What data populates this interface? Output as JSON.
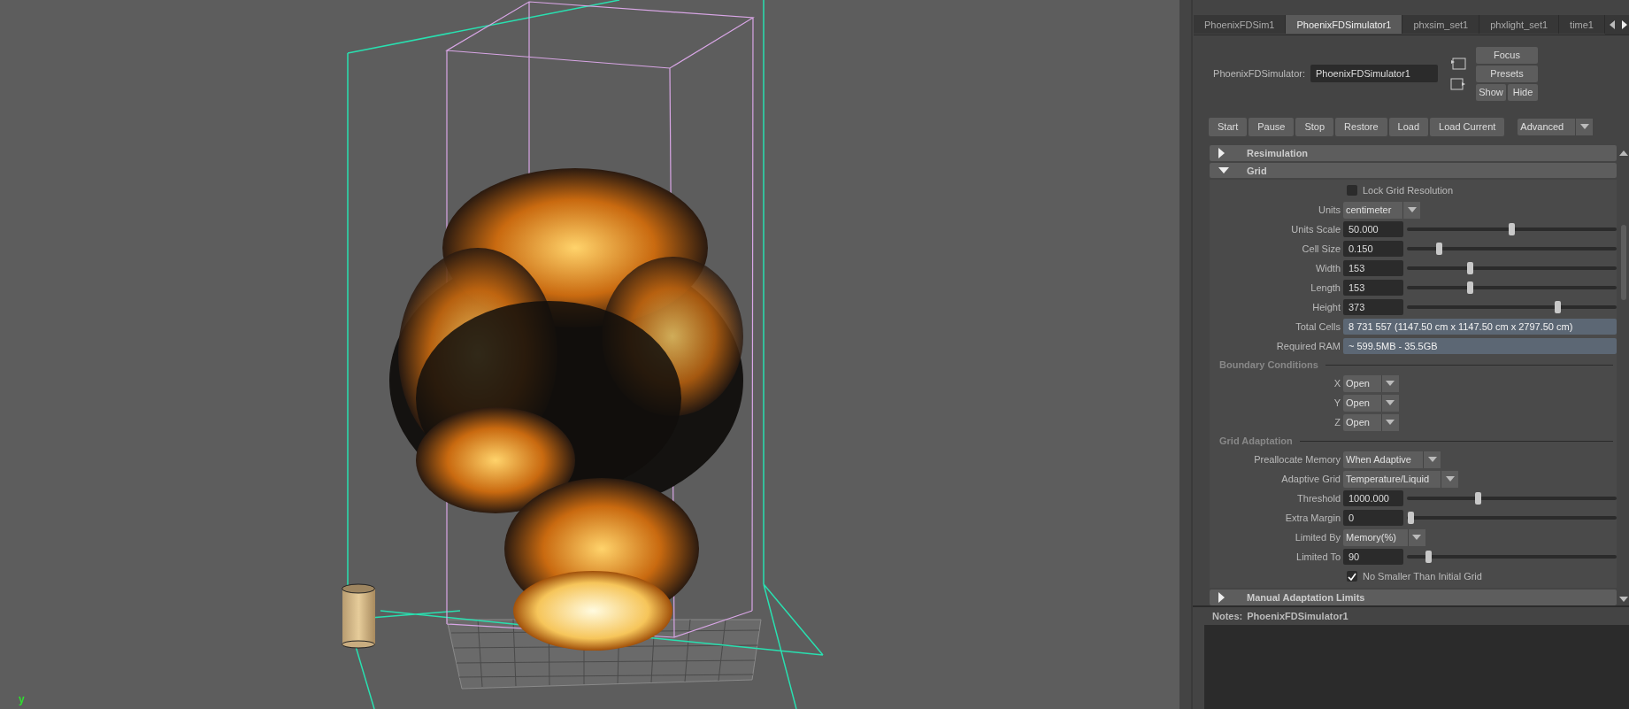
{
  "viewport": {
    "axis_label": "y"
  },
  "tabs": [
    {
      "label": "PhoenixFDSim1",
      "selected": false
    },
    {
      "label": "PhoenixFDSimulator1",
      "selected": true
    },
    {
      "label": "phxsim_set1",
      "selected": false
    },
    {
      "label": "phxlight_set1",
      "selected": false
    },
    {
      "label": "time1",
      "selected": false
    }
  ],
  "node": {
    "label": "PhoenixFDSimulator:",
    "value": "PhoenixFDSimulator1"
  },
  "node_buttons": [
    "Focus",
    "Presets"
  ],
  "view_buttons": [
    "Show",
    "Hide"
  ],
  "actions": [
    "Start",
    "Pause",
    "Stop",
    "Restore",
    "Load",
    "Load Current"
  ],
  "mode": {
    "value": "Advanced"
  },
  "sections": [
    {
      "title": "Resimulation",
      "expanded": false
    },
    {
      "title": "Grid",
      "expanded": true,
      "rows": [
        {
          "kind": "checkbox",
          "label": "Lock Grid Resolution",
          "checked": false
        },
        {
          "kind": "dropdown",
          "label": "Units",
          "value": "centimeter"
        },
        {
          "kind": "slider",
          "label": "Units Scale",
          "value": "50.000",
          "level": 0.5
        },
        {
          "kind": "slider",
          "label": "Cell Size",
          "value": "0.150",
          "level": 0.156
        },
        {
          "kind": "slider",
          "label": "Width",
          "value": "153",
          "level": 0.305
        },
        {
          "kind": "slider",
          "label": "Length",
          "value": "153",
          "level": 0.305
        },
        {
          "kind": "slider",
          "label": "Height",
          "value": "373",
          "level": 0.72
        },
        {
          "kind": "readout",
          "label": "Total Cells",
          "value": "8 731 557 (1147.50 cm x 1147.50 cm x 2797.50 cm)"
        },
        {
          "kind": "readout",
          "label": "Required RAM",
          "value": "~ 599.5MB - 35.5GB"
        },
        {
          "kind": "heading",
          "label": "Boundary Conditions"
        },
        {
          "kind": "dropdown",
          "label": "X",
          "value": "Open"
        },
        {
          "kind": "dropdown",
          "label": "Y",
          "value": "Open"
        },
        {
          "kind": "dropdown",
          "label": "Z",
          "value": "Open"
        },
        {
          "kind": "heading",
          "label": "Grid Adaptation"
        },
        {
          "kind": "dropdown",
          "label": "Preallocate Memory",
          "value": "When Adaptive"
        },
        {
          "kind": "dropdown",
          "label": "Adaptive Grid",
          "value": "Temperature/Liquid"
        },
        {
          "kind": "slider",
          "label": "Threshold",
          "value": "1000.000",
          "level": 0.34
        },
        {
          "kind": "slider",
          "label": "Extra Margin",
          "value": "0",
          "level": 0.02
        },
        {
          "kind": "dropdown",
          "label": "Limited By",
          "value": "Memory(%)"
        },
        {
          "kind": "slider",
          "label": "Limited To",
          "value": "90",
          "level": 0.107
        },
        {
          "kind": "checkbox",
          "label": "No Smaller Than Initial Grid",
          "checked": true
        }
      ]
    },
    {
      "title": "Manual Adaptation Limits",
      "expanded": false
    }
  ],
  "notes": {
    "label": "Notes:",
    "node": "PhoenixFDSimulator1"
  }
}
